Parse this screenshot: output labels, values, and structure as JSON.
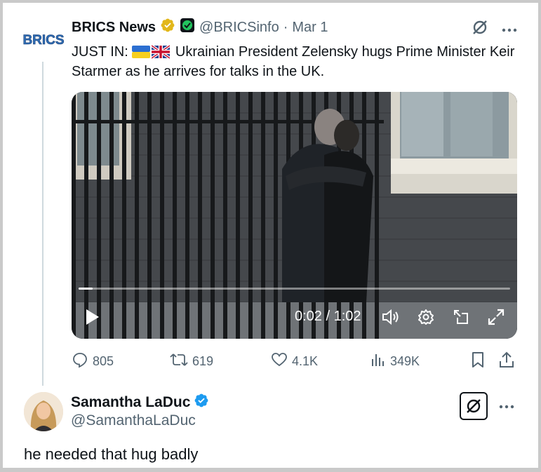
{
  "quoted_tweet": {
    "avatar_text": "BRICS",
    "author_name": "BRICS News",
    "handle": "@BRICSinfo",
    "separator": "·",
    "date": "Mar 1",
    "text_prefix": "JUST IN:",
    "text_body": "Ukrainian President Zelensky hugs Prime Minister Keir Starmer as he arrives for talks in the UK.",
    "video": {
      "current_time": "0:02",
      "duration": "1:02",
      "time_display": "0:02 / 1:02",
      "progress_fraction": 0.032
    },
    "metrics": {
      "replies": "805",
      "reposts": "619",
      "likes": "4.1K",
      "views": "349K"
    }
  },
  "reply": {
    "author_name": "Samantha LaDuc",
    "handle": "@SamanthaLaDuc",
    "text": "he needed that hug badly"
  },
  "colors": {
    "verified_gold": "#e2b719",
    "verified_blue": "#1d9bf0",
    "secondary_text": "#536471",
    "primary_text": "#0f1419"
  },
  "icons": [
    "grok-icon",
    "more-icon",
    "play-icon",
    "volume-icon",
    "settings-icon",
    "pip-icon",
    "fullscreen-icon",
    "reply-icon",
    "repost-icon",
    "like-icon",
    "views-icon",
    "bookmark-icon",
    "share-icon"
  ]
}
